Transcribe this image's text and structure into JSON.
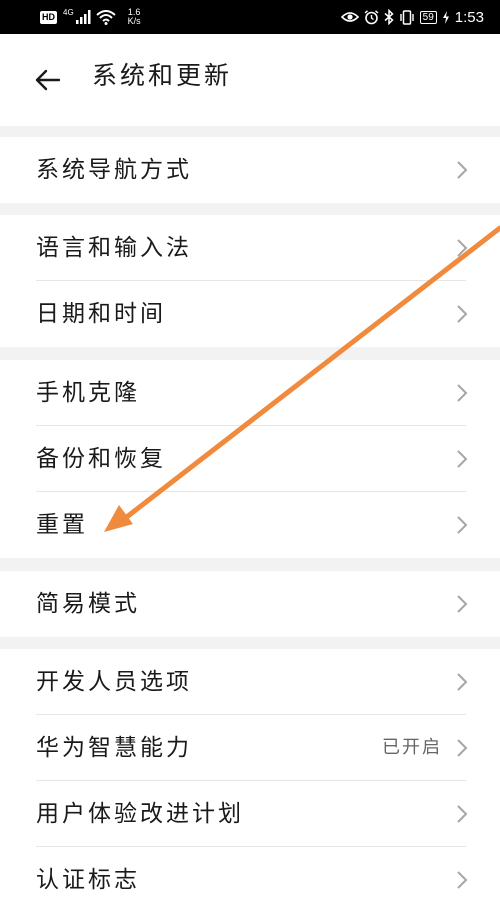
{
  "status_bar": {
    "hd": "HD",
    "network": "4G",
    "speed_value": "1.6",
    "speed_unit": "K/s",
    "battery": "59",
    "time": "1:53",
    "icons": [
      "eye-icon",
      "alarm-icon",
      "bluetooth-icon",
      "vibrate-icon",
      "battery-icon",
      "charging-icon",
      "signal-icon",
      "wifi-icon"
    ]
  },
  "header": {
    "title": "系统和更新",
    "back_icon": "back-arrow-icon"
  },
  "groups": [
    {
      "items": [
        {
          "label": "系统导航方式",
          "value": ""
        }
      ]
    },
    {
      "items": [
        {
          "label": "语言和输入法",
          "value": ""
        },
        {
          "label": "日期和时间",
          "value": ""
        }
      ]
    },
    {
      "items": [
        {
          "label": "手机克隆",
          "value": ""
        },
        {
          "label": "备份和恢复",
          "value": ""
        },
        {
          "label": "重置",
          "value": ""
        }
      ]
    },
    {
      "items": [
        {
          "label": "简易模式",
          "value": ""
        }
      ]
    },
    {
      "items": [
        {
          "label": "开发人员选项",
          "value": ""
        },
        {
          "label": "华为智慧能力",
          "value": "已开启"
        },
        {
          "label": "用户体验改进计划",
          "value": ""
        },
        {
          "label": "认证标志",
          "value": ""
        }
      ]
    }
  ],
  "annotation": {
    "color": "#f08a3c",
    "target": "重置"
  }
}
